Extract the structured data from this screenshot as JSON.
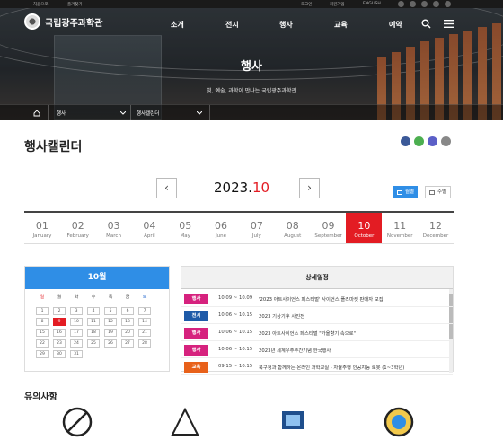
{
  "topbar": {
    "home": "처음으로",
    "fav": "즐겨찾기",
    "login": "로그인",
    "join": "회원가입",
    "lang": "ENGLISH"
  },
  "header": {
    "logo": "국립광주과학관",
    "menu": [
      "소개",
      "전시",
      "행사",
      "교육",
      "예약"
    ]
  },
  "hero": {
    "title": "행사",
    "subtitle": "빛, 예술, 과학이 만나는 국립광주과학관"
  },
  "breadcrumb": {
    "level1": "행사",
    "level2": "행사캘린더"
  },
  "page": {
    "title": "행사캘린더"
  },
  "calendar_nav": {
    "year": "2023.",
    "month": "10",
    "view_month": "월별",
    "view_week": "주별"
  },
  "months": [
    {
      "n": "01",
      "e": "January"
    },
    {
      "n": "02",
      "e": "February"
    },
    {
      "n": "03",
      "e": "March"
    },
    {
      "n": "04",
      "e": "April"
    },
    {
      "n": "05",
      "e": "May"
    },
    {
      "n": "06",
      "e": "June"
    },
    {
      "n": "07",
      "e": "July"
    },
    {
      "n": "08",
      "e": "August"
    },
    {
      "n": "09",
      "e": "September"
    },
    {
      "n": "10",
      "e": "October"
    },
    {
      "n": "11",
      "e": "November"
    },
    {
      "n": "12",
      "e": "December"
    }
  ],
  "mini_cal": {
    "title": "10월",
    "weekdays": [
      "일",
      "월",
      "화",
      "수",
      "목",
      "금",
      "토"
    ],
    "weeks": [
      [
        "1",
        "2",
        "3",
        "4",
        "5",
        "6",
        "7"
      ],
      [
        "8",
        "9",
        "10",
        "11",
        "12",
        "13",
        "14"
      ],
      [
        "15",
        "16",
        "17",
        "18",
        "19",
        "20",
        "21"
      ],
      [
        "22",
        "23",
        "24",
        "25",
        "26",
        "27",
        "28"
      ],
      [
        "29",
        "30",
        "31"
      ]
    ]
  },
  "details": {
    "title": "상세일정",
    "rows": [
      {
        "tag": "행사",
        "color": "#d6227e",
        "date": "10.09 ~ 10.09",
        "title": "'2023 아트사이언스 페스티벌' 사이언스 플리마켓 판매자 모집"
      },
      {
        "tag": "전시",
        "color": "#1e5aa8",
        "date": "10.06 ~ 10.15",
        "title": "2023 기상기후 사진전"
      },
      {
        "tag": "행사",
        "color": "#d6227e",
        "date": "10.06 ~ 10.15",
        "title": "2023 아트사이언스 페스티벌 \"가을향기 속으로\""
      },
      {
        "tag": "행사",
        "color": "#d6227e",
        "date": "10.06 ~ 10.15",
        "title": "2023년 세계우주주간기념 한국행사"
      },
      {
        "tag": "교육",
        "color": "#e8611a",
        "date": "09.15 ~ 10.15",
        "title": "북구청과 함께하는 온라인 과학교실 - 자율주행 인공지능 로봇 (1~3학년)"
      }
    ]
  },
  "notice": {
    "title": "유의사항"
  },
  "colors": {
    "accent": "#e31c23",
    "calendar_head": "#2f8ee6"
  }
}
